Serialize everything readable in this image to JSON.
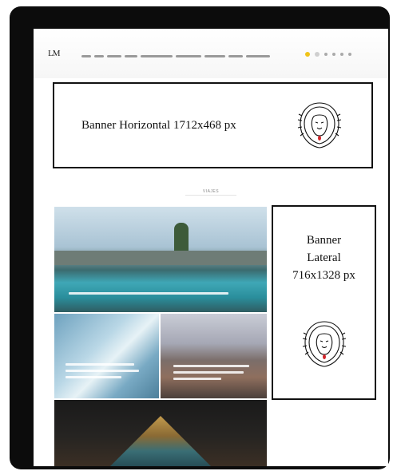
{
  "header": {
    "logo_text": "LM",
    "nav_items": [
      "MUJER",
      "MODA",
      "ESTILOS",
      "BELLEZA",
      "GRANDES REPORTAJES",
      "ENTREVISTAS",
      "TENDENCIAS",
      "VÍAS",
      "ZONA LUJOSA"
    ]
  },
  "banners": {
    "horizontal_label": "Banner Horizontal 1712x468 px",
    "vertical_line1": "Banner",
    "vertical_line2": "Lateral",
    "vertical_line3": "716x1328 px"
  },
  "section": {
    "label": "VIAJES"
  },
  "colors": {
    "frame": "#0c0c0c",
    "banner_border": "#111111",
    "lion_accent": "#d2252a"
  },
  "icons": [
    "lion-logo-icon",
    "search-icon",
    "menu-icon",
    "social-icon"
  ]
}
